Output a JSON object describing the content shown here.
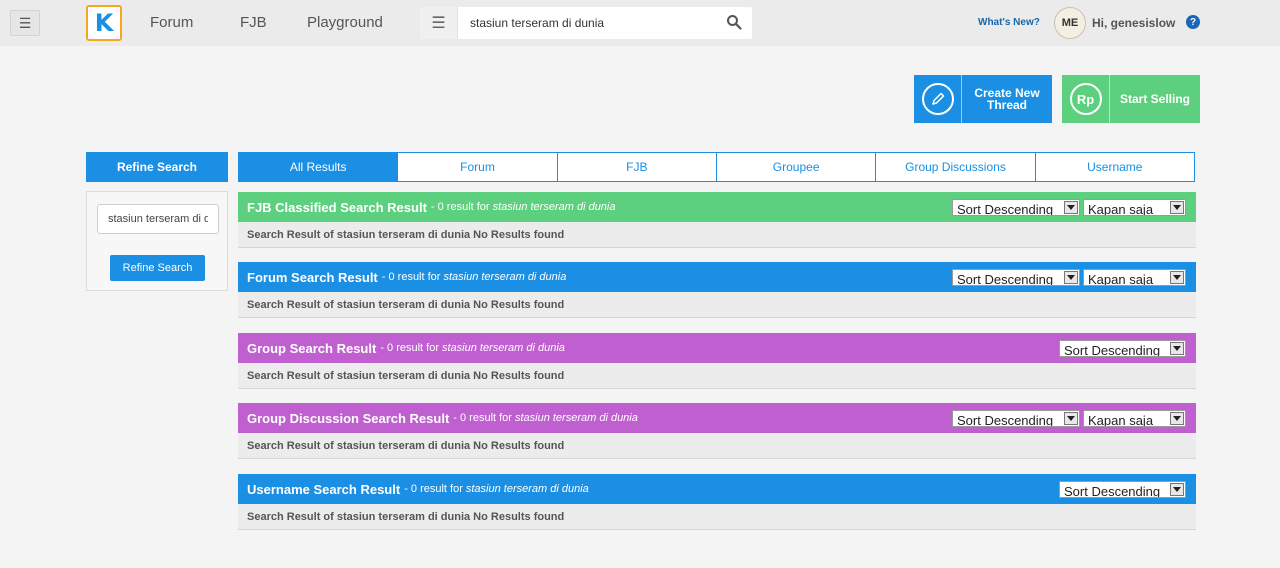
{
  "header": {
    "nav": [
      "Forum",
      "FJB",
      "Playground"
    ],
    "search_value": "stasiun terseram di dunia",
    "whats_new": "What's New?",
    "avatar_text": "ME",
    "greeting": "Hi, genesislow",
    "help": "?"
  },
  "actions": {
    "create_label": "Create New Thread",
    "sell_label": "Start Selling",
    "sell_icon_text": "Rp"
  },
  "sidebar": {
    "title": "Refine Search",
    "input_value": "stasiun terseram di dunia",
    "button_label": "Refine Search"
  },
  "tabs": [
    "All Results",
    "Forum",
    "FJB",
    "Groupee",
    "Group Discussions",
    "Username"
  ],
  "sections": [
    {
      "title": "FJB Classified Search Result",
      "count": "- 0 result for",
      "query": "stasiun terseram di dunia",
      "body": "Search Result of stasiun terseram di dunia No Results found",
      "sort": "Sort Descending",
      "time": "Kapan saja",
      "color": "#5cd07e"
    },
    {
      "title": "Forum Search Result",
      "count": "- 0 result for",
      "query": "stasiun terseram di dunia",
      "body": "Search Result of stasiun terseram di dunia No Results found",
      "sort": "Sort Descending",
      "time": "Kapan saja",
      "color": "#1a8fe3"
    },
    {
      "title": "Group Search Result",
      "count": "- 0 result for",
      "query": "stasiun terseram di dunia",
      "body": "Search Result of stasiun terseram di dunia No Results found",
      "sort": "Sort Descending",
      "color": "#c060d0"
    },
    {
      "title": "Group Discussion Search Result",
      "count": "- 0 result for",
      "query": "stasiun terseram di dunia",
      "body": "Search Result of stasiun terseram di dunia No Results found",
      "sort": "Sort Descending",
      "time": "Kapan saja",
      "color": "#c060d0"
    },
    {
      "title": "Username Search Result",
      "count": "- 0 result for",
      "query": "stasiun terseram di dunia",
      "body": "Search Result of stasiun terseram di dunia No Results found",
      "sort": "Sort Descending",
      "color": "#1a8fe3"
    }
  ]
}
